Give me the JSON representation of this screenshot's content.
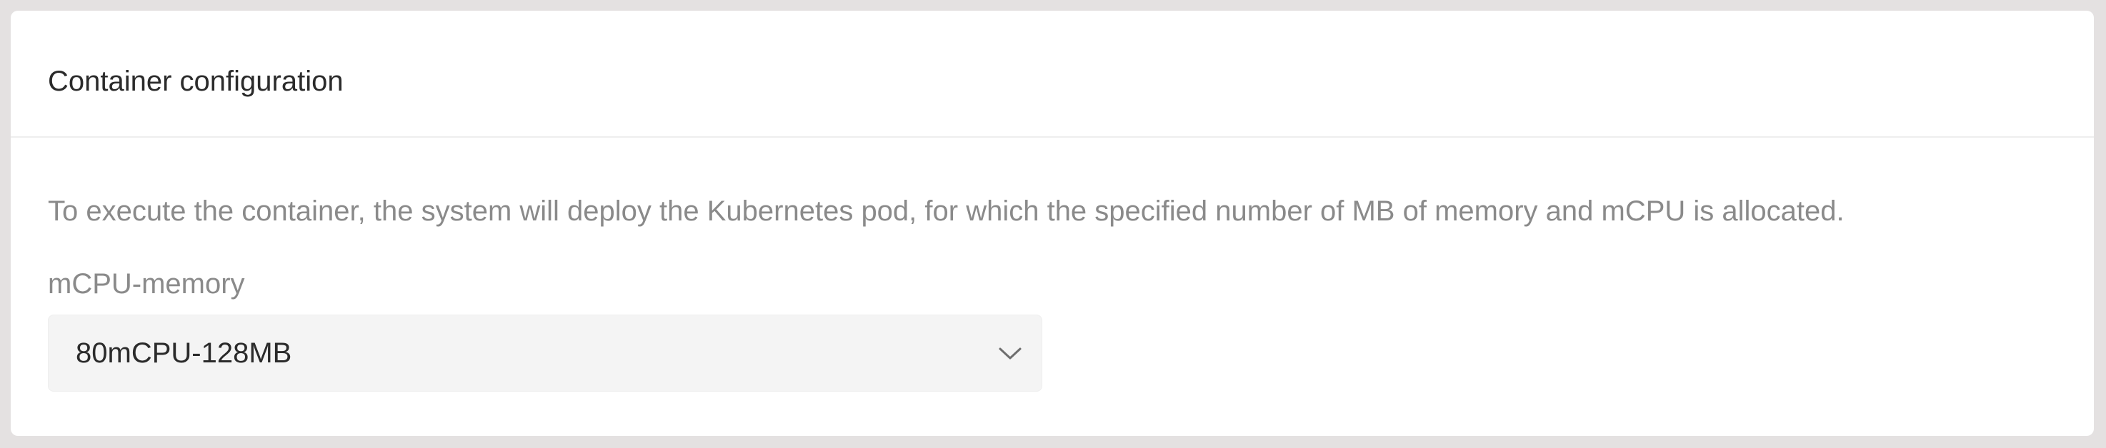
{
  "panel": {
    "title": "Container configuration",
    "description": "To execute the container, the system will deploy the Kubernetes pod, for which the specified number of MB of memory and mCPU is allocated."
  },
  "field": {
    "label": "mCPU-memory",
    "selected_value": "80mCPU-128MB",
    "icon": "chevron-down-icon"
  },
  "colors": {
    "background": "#e4e1e1",
    "panel": "#ffffff",
    "select_background": "#f4f4f4",
    "title_text": "#2b2b2b",
    "muted_text": "#8a8a8a"
  }
}
